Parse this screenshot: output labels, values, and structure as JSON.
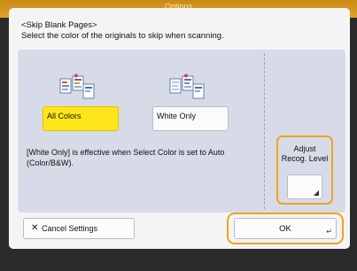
{
  "header": {
    "title": "Options"
  },
  "dialog": {
    "title_line1": "<Skip Blank Pages>",
    "title_line2": "Select the color of the originals to skip when scanning."
  },
  "options": {
    "all_colors_label": "All Colors",
    "white_only_label": "White Only",
    "selected": "All Colors"
  },
  "note": "[White Only] is effective when Select Color is set to Auto (Color/B&W).",
  "adjust": {
    "label_line1": "Adjust",
    "label_line2": "Recog. Level"
  },
  "footer": {
    "cancel_label": "Cancel Settings",
    "ok_label": "OK"
  },
  "colors": {
    "selected_option": "#ffe61a",
    "highlight_border": "#f2a11d",
    "panel": "#d6dbe7"
  },
  "icons": {
    "all_colors": "color-pages-icon",
    "white_only": "white-pages-icon",
    "cancel": "close-icon",
    "enter": "enter-icon",
    "corner": "corner-mark-icon"
  }
}
